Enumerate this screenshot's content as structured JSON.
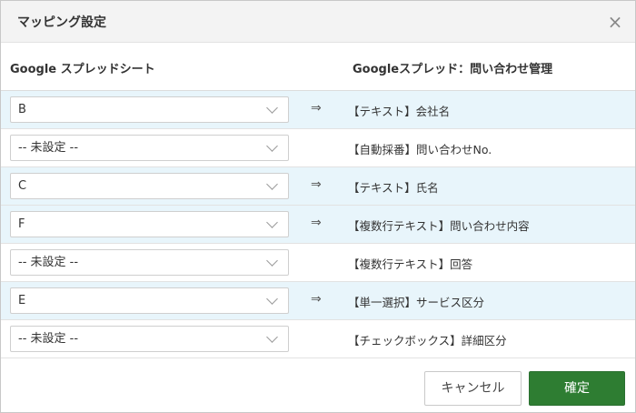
{
  "dialog": {
    "title": "マッピング設定",
    "close_icon": "×"
  },
  "columns": {
    "left_header": "Google スプレッドシート",
    "right_header": "Googleスプレッド：問い合わせ管理"
  },
  "rows": [
    {
      "selected": "B",
      "mapped": true,
      "arrow": "⇒",
      "field": "【テキスト】会社名"
    },
    {
      "selected": "-- 未設定 --",
      "mapped": false,
      "arrow": "",
      "field": "【自動採番】問い合わせNo."
    },
    {
      "selected": "C",
      "mapped": true,
      "arrow": "⇒",
      "field": "【テキスト】氏名"
    },
    {
      "selected": "F",
      "mapped": true,
      "arrow": "⇒",
      "field": "【複数行テキスト】問い合わせ内容"
    },
    {
      "selected": "-- 未設定 --",
      "mapped": false,
      "arrow": "",
      "field": "【複数行テキスト】回答"
    },
    {
      "selected": "E",
      "mapped": true,
      "arrow": "⇒",
      "field": "【単一選択】サービス区分"
    },
    {
      "selected": "-- 未設定 --",
      "mapped": false,
      "arrow": "",
      "field": "【チェックボックス】詳細区分"
    }
  ],
  "footer": {
    "cancel_label": "キャンセル",
    "confirm_label": "確定"
  },
  "colors": {
    "mapped_row_bg": "#e8f5fb",
    "confirm_button": "#2e7d32"
  }
}
